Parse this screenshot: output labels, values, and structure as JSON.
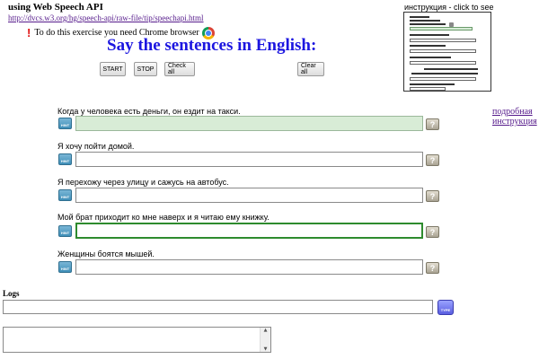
{
  "header": {
    "title": "using Web Speech API",
    "link": "http://dvcs.w3.org/hg/speech-api/raw-file/tip/speechapi.html",
    "note_excl": "!",
    "note": "To do this exercise you need Chrome browser",
    "main_title": "Say the sentences in English:"
  },
  "toolbar": {
    "start": "START",
    "stop": "STOP",
    "check_all": "Check all",
    "clear_all": "Clear all"
  },
  "instruction": {
    "caption": "инструкция - click to see"
  },
  "detail_link": {
    "line1": "подробная",
    "line2": "инструкция"
  },
  "exercises": [
    {
      "sentence": "Когда у человека есть деньги, он ездит на такси.",
      "answer": "",
      "state": "correct"
    },
    {
      "sentence": "Я хочу пойти домой.",
      "answer": "",
      "state": "normal"
    },
    {
      "sentence": "Я перехожу через улицу и сажусь на автобус.",
      "answer": "",
      "state": "normal"
    },
    {
      "sentence": "Мой брат приходит ко мне наверх и я читаю ему книжку.",
      "answer": "",
      "state": "focused"
    },
    {
      "sentence": "Женщины боятся мышей.",
      "answer": "",
      "state": "normal"
    }
  ],
  "hint_label": "HINT",
  "help_label": "?",
  "logs": {
    "label": "Logs",
    "input_value": "",
    "type_label": "TYPE",
    "textarea_value": ""
  },
  "icons": {
    "chrome": "chrome-logo-icon",
    "hint": "hint-icon",
    "help": "help-question-icon",
    "type": "type-keyboard-icon"
  },
  "colors": {
    "title_blue": "#1c16e0",
    "link_purple": "#551a8b",
    "correct_green": "#d8ecd6",
    "focus_green": "#2e8b2e",
    "excl_red": "#e01010"
  }
}
